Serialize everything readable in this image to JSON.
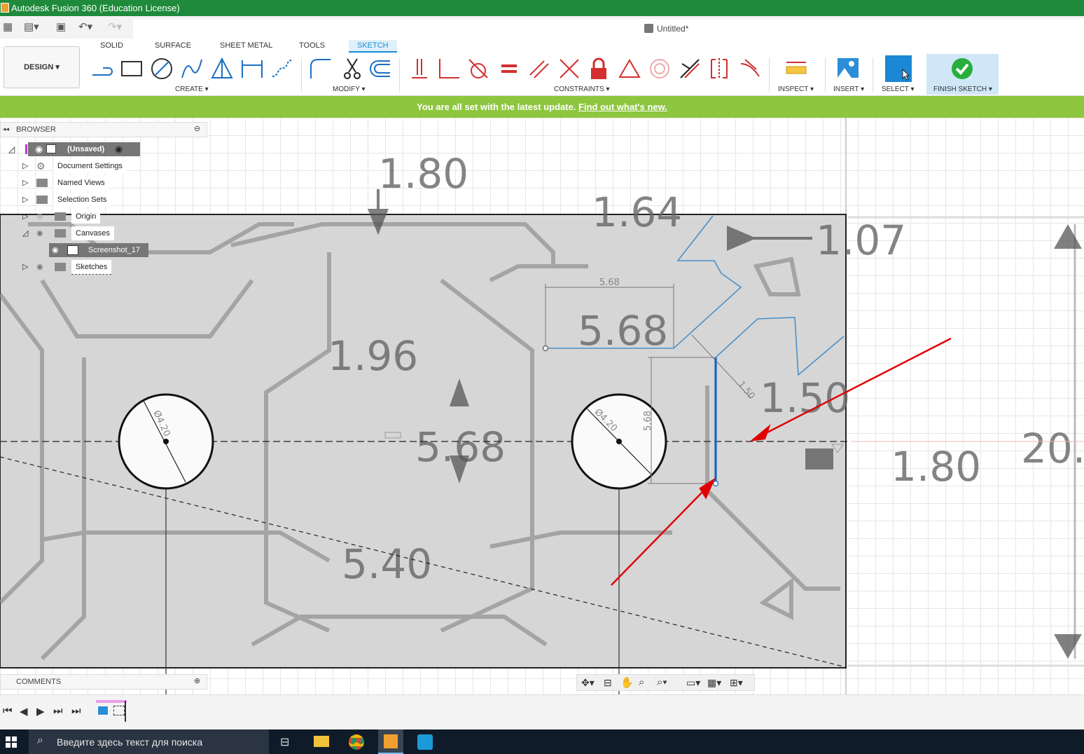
{
  "window": {
    "title": "Autodesk Fusion 360 (Education License)"
  },
  "document": {
    "title": "Untitled*"
  },
  "workspace": {
    "label": "DESIGN"
  },
  "tabs": [
    "SOLID",
    "SURFACE",
    "SHEET METAL",
    "TOOLS",
    "SKETCH"
  ],
  "active_tab": "SKETCH",
  "groups": {
    "create": "CREATE",
    "modify": "MODIFY",
    "constraints": "CONSTRAINTS",
    "inspect": "INSPECT",
    "insert": "INSERT",
    "select": "SELECT",
    "finish": "FINISH SKETCH"
  },
  "banner": {
    "text": "You are all set with the latest update.",
    "link": "Find out what's new."
  },
  "browser": {
    "title": "BROWSER",
    "root": "(Unsaved)",
    "items": [
      "Document Settings",
      "Named Views",
      "Selection Sets",
      "Origin",
      "Canvases",
      "Screenshot_17",
      "Sketches"
    ]
  },
  "comments": {
    "title": "COMMENTS"
  },
  "canvas": {
    "image_dims": [
      "1.80",
      "1.64",
      "1.07",
      "1.96",
      "5.68",
      "1.50",
      "1.80",
      "20.",
      "5.40",
      "5.68"
    ],
    "sketch_dims": [
      "5.68",
      "Ø4.20",
      "Ø4.20",
      "5.68",
      "1.50"
    ]
  },
  "taskbar": {
    "search_placeholder": "Введите здесь текст для поиска"
  },
  "colors": {
    "titlebar": "#1f8a3c",
    "banner": "#8dc63f",
    "accent": "#1a8bd6",
    "sketch_line": "#1565c0",
    "annotation_arrow": "#e00000"
  }
}
